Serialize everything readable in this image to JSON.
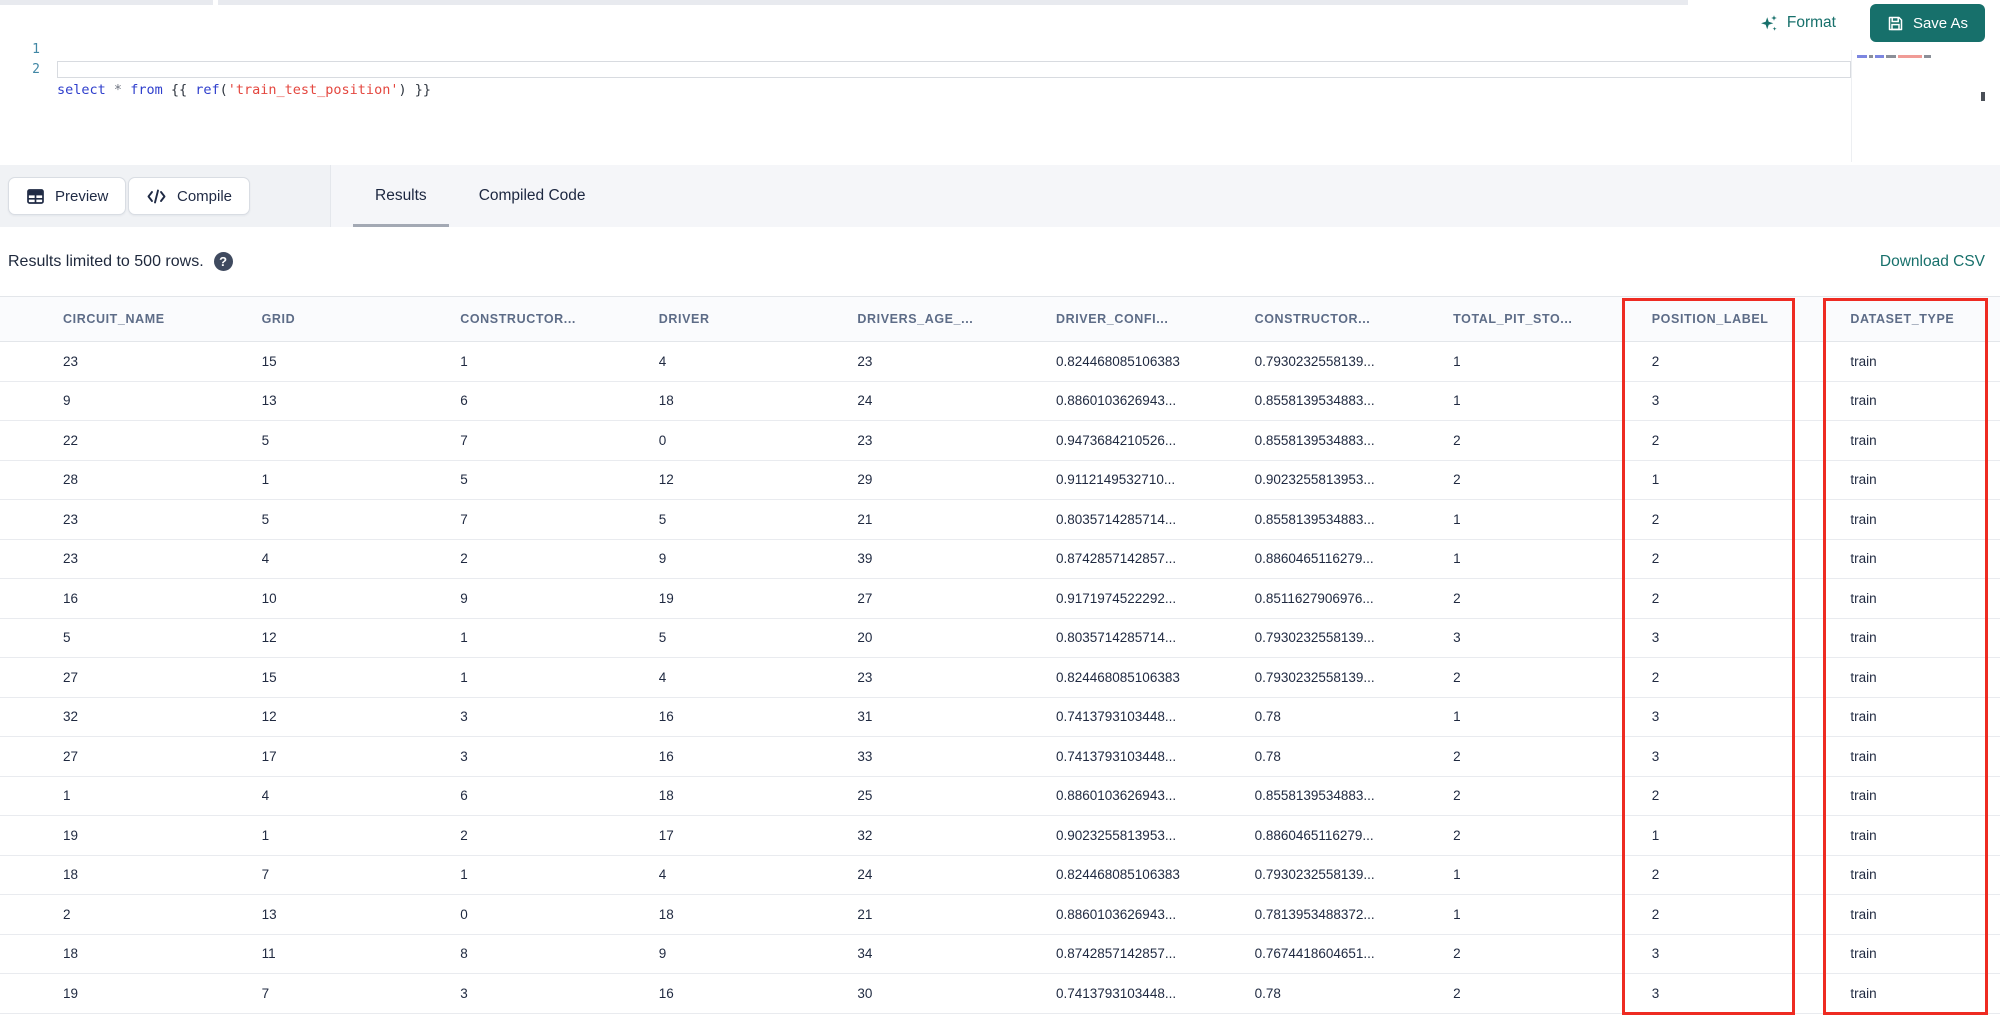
{
  "editor": {
    "line_numbers": [
      "1",
      "2"
    ],
    "code_line": [
      {
        "text": "select",
        "type": "keyword"
      },
      {
        "text": " ",
        "type": "punct"
      },
      {
        "text": "*",
        "type": "operator"
      },
      {
        "text": " ",
        "type": "punct"
      },
      {
        "text": "from",
        "type": "keyword"
      },
      {
        "text": " {{ ",
        "type": "punct"
      },
      {
        "text": "ref",
        "type": "function"
      },
      {
        "text": "(",
        "type": "punct"
      },
      {
        "text": "'train_test_position'",
        "type": "string"
      },
      {
        "text": ")",
        "type": "punct"
      },
      {
        "text": " }}",
        "type": "punct"
      }
    ]
  },
  "actions": {
    "format_label": "Format",
    "save_as_label": "Save As"
  },
  "toolbar": {
    "preview_label": "Preview",
    "compile_label": "Compile"
  },
  "tabs": [
    {
      "label": "Results",
      "active": true
    },
    {
      "label": "Compiled Code",
      "active": false
    }
  ],
  "results_bar": {
    "info_text": "Results limited to 500 rows.",
    "help_icon": "?",
    "download_label": "Download CSV"
  },
  "table": {
    "columns": [
      "CIRCUIT_NAME",
      "GRID",
      "CONSTRUCTOR...",
      "DRIVER",
      "DRIVERS_AGE_...",
      "DRIVER_CONFI...",
      "CONSTRUCTOR...",
      "TOTAL_PIT_STO...",
      "POSITION_LABEL",
      "DATASET_TYPE"
    ],
    "highlighted_columns": [
      "POSITION_LABEL",
      "DATASET_TYPE"
    ],
    "rows": [
      [
        "23",
        "15",
        "1",
        "4",
        "23",
        "0.824468085106383",
        "0.7930232558139...",
        "1",
        "2",
        "train"
      ],
      [
        "9",
        "13",
        "6",
        "18",
        "24",
        "0.8860103626943...",
        "0.8558139534883...",
        "1",
        "3",
        "train"
      ],
      [
        "22",
        "5",
        "7",
        "0",
        "23",
        "0.9473684210526...",
        "0.8558139534883...",
        "2",
        "2",
        "train"
      ],
      [
        "28",
        "1",
        "5",
        "12",
        "29",
        "0.9112149532710...",
        "0.9023255813953...",
        "2",
        "1",
        "train"
      ],
      [
        "23",
        "5",
        "7",
        "5",
        "21",
        "0.8035714285714...",
        "0.8558139534883...",
        "1",
        "2",
        "train"
      ],
      [
        "23",
        "4",
        "2",
        "9",
        "39",
        "0.8742857142857...",
        "0.8860465116279...",
        "1",
        "2",
        "train"
      ],
      [
        "16",
        "10",
        "9",
        "19",
        "27",
        "0.9171974522292...",
        "0.8511627906976...",
        "2",
        "2",
        "train"
      ],
      [
        "5",
        "12",
        "1",
        "5",
        "20",
        "0.8035714285714...",
        "0.7930232558139...",
        "3",
        "3",
        "train"
      ],
      [
        "27",
        "15",
        "1",
        "4",
        "23",
        "0.824468085106383",
        "0.7930232558139...",
        "2",
        "2",
        "train"
      ],
      [
        "32",
        "12",
        "3",
        "16",
        "31",
        "0.7413793103448...",
        "0.78",
        "1",
        "3",
        "train"
      ],
      [
        "27",
        "17",
        "3",
        "16",
        "33",
        "0.7413793103448...",
        "0.78",
        "2",
        "3",
        "train"
      ],
      [
        "1",
        "4",
        "6",
        "18",
        "25",
        "0.8860103626943...",
        "0.8558139534883...",
        "2",
        "2",
        "train"
      ],
      [
        "19",
        "1",
        "2",
        "17",
        "32",
        "0.9023255813953...",
        "0.8860465116279...",
        "2",
        "1",
        "train"
      ],
      [
        "18",
        "7",
        "1",
        "4",
        "24",
        "0.824468085106383",
        "0.7930232558139...",
        "1",
        "2",
        "train"
      ],
      [
        "2",
        "13",
        "0",
        "18",
        "21",
        "0.8860103626943...",
        "0.7813953488372...",
        "1",
        "2",
        "train"
      ],
      [
        "18",
        "11",
        "8",
        "9",
        "34",
        "0.8742857142857...",
        "0.7674418604651...",
        "2",
        "3",
        "train"
      ],
      [
        "19",
        "7",
        "3",
        "16",
        "30",
        "0.7413793103448...",
        "0.78",
        "2",
        "3",
        "train"
      ]
    ]
  },
  "colors": {
    "accent_teal": "#17706b",
    "annotation_red": "#ee2b22",
    "keyword_blue": "#2e3ecc",
    "string_red": "#e4473f"
  }
}
